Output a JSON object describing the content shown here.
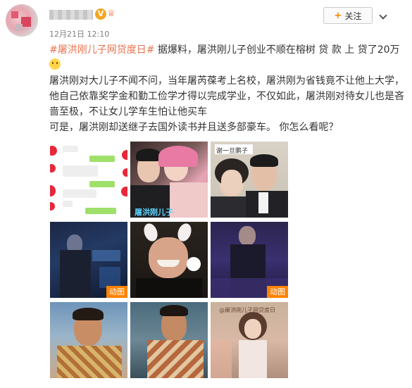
{
  "post": {
    "timestamp": "12月21日 12:10",
    "follow_plus": "+",
    "follow_label": "关注",
    "hashtag": "#屠洪刚儿子网贷度日#",
    "headline": " 据爆料，屠洪刚儿子创业不顺在榕树 贷 款 上 贷了20万",
    "line1": "屠洪刚对大儿子不闻不问，当年屠芮葆考上名校，屠洪刚为省钱竟不让他上大学，他自己依靠奖学金和勤工俭学才得以完成学业，不仅如此，屠洪刚对待女儿也是吝啬至极，不让女儿学车生怕让他买车",
    "line2": "可是，屠洪刚却送继子去国外读书并且送多部豪车。 你怎么看呢？"
  },
  "images": {
    "gif_label": "动图",
    "cap_watermark1": "屠洪刚儿子",
    "cap_watermark2": "谢一旦鹏子",
    "cap_watermark3": "@屠洪刚儿子网贷度日"
  },
  "colors": {
    "hashtag": "#eb7350",
    "gif_badge": "#ff8200",
    "follow_plus": "#ff8200"
  }
}
